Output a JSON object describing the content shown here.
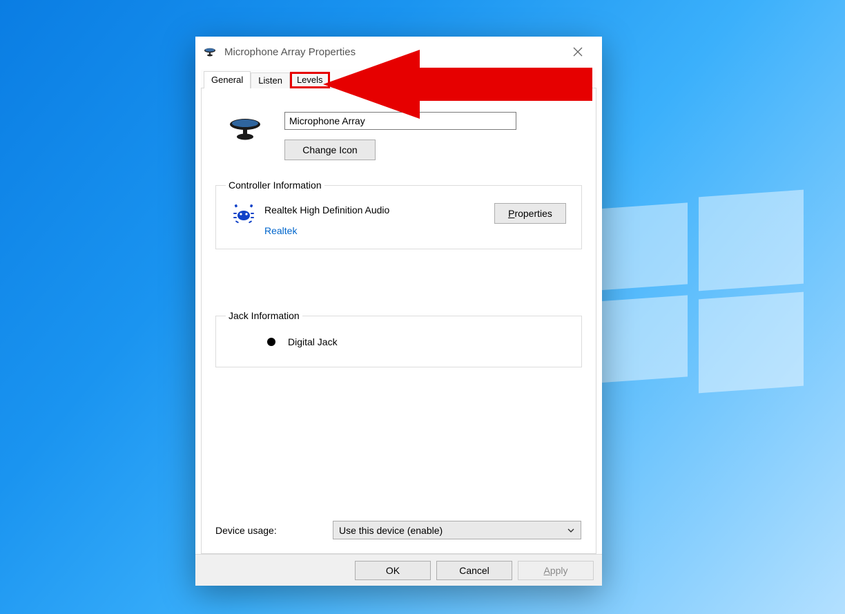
{
  "window": {
    "title": "Microphone Array Properties"
  },
  "tabs": {
    "general": "General",
    "listen": "Listen",
    "levels": "Levels"
  },
  "general": {
    "device_name": "Microphone Array",
    "change_icon": "Change Icon"
  },
  "controller": {
    "legend": "Controller Information",
    "name": "Realtek High Definition Audio",
    "vendor": "Realtek",
    "properties_prefix": "P",
    "properties_rest": "roperties"
  },
  "jack": {
    "legend": "Jack Information",
    "label": "Digital Jack"
  },
  "usage": {
    "label": "Device usage:",
    "selected": "Use this device (enable)"
  },
  "footer": {
    "ok": "OK",
    "cancel": "Cancel",
    "apply_prefix": "A",
    "apply_rest": "pply"
  }
}
